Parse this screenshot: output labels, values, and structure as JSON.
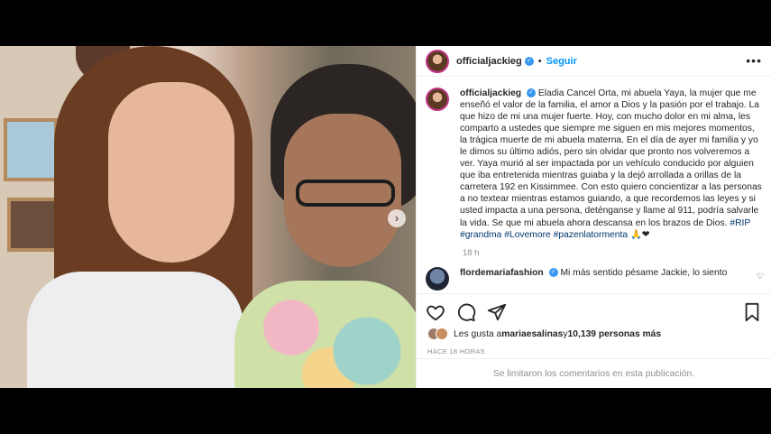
{
  "post": {
    "username": "officialjackieg",
    "verified_glyph": "✓",
    "separator": "•",
    "follow_label": "Seguir",
    "more_options_glyph": "•••",
    "carousel_next_glyph": "›"
  },
  "caption": {
    "username": "officialjackieg",
    "verified_glyph": "✓",
    "text": " Eladia Cancel Orta, mi abuela Yaya, la mujer que me enseñó el valor de la familia, el amor a Dios y la pasión por el trabajo. La que hizo de mi una mujer fuerte. Hoy, con mucho dolor en mi alma, les comparto a ustedes que siempre me siguen en mis mejores momentos, la trágica muerte de mi abuela materna. En el día de ayer mi familia y yo le dimos su último adiós, pero sin olvidar que pronto nos volveremos a ver. Yaya murió al ser impactada por un vehículo conducido por alguien que iba entretenida mientras guiaba y la dejó arrollada a orillas de la carretera 192 en Kissimmee. Con esto quiero concientizar a las personas a no textear mientras estamos guiando, a que recordemos las leyes y si usted impacta a una persona, deténganse y llame al 911, podría salvarle la vida. Se que mi abuela ahora descansa en los brazos de Dios. ",
    "hashtags": [
      "#RIP",
      "#grandma",
      "#Lovemore",
      "#pazenlatormenta"
    ],
    "emoji": "🙏❤",
    "time": "18 h"
  },
  "comment": {
    "username": "flordemariafashion",
    "verified_glyph": "✓",
    "text": " Mi más sentido pésame Jackie, lo siento",
    "like_glyph": "♡"
  },
  "likes": {
    "prefix": "Les gusta a ",
    "user": "mariaesalinas",
    "middle": " y ",
    "count": "10,139 personas más"
  },
  "posted_ago": "HACE 18 HORAS",
  "comments_limited": "Se limitaron los comentarios en esta publicación."
}
